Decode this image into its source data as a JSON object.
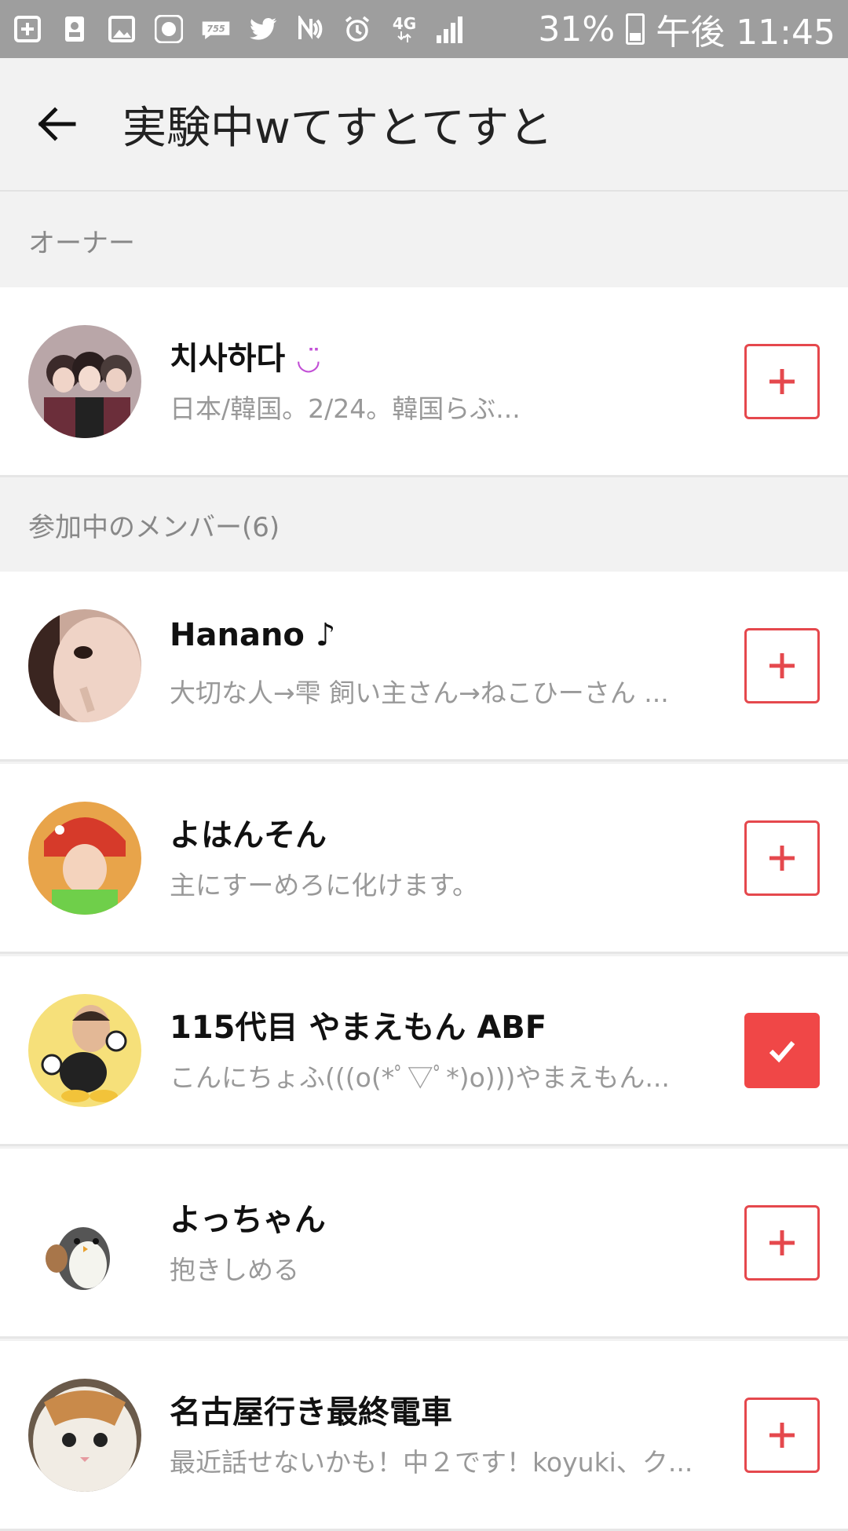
{
  "status_bar": {
    "battery": "31%",
    "time": "午後 11:45",
    "network": "4G",
    "icons": [
      "plus-box-icon",
      "contacts-icon",
      "image-icon",
      "owl-app-icon",
      "755-app-icon",
      "twitter-icon",
      "nfc-icon",
      "alarm-icon",
      "network-4g-icon",
      "signal-icon",
      "battery-icon"
    ]
  },
  "header": {
    "title": "実験中wてすとてすと"
  },
  "owner_section": {
    "label": "オーナー"
  },
  "owner": {
    "name": "치사하다",
    "desc": "日本/韓国。2/24。韓国らぶ..."
  },
  "members_section": {
    "label": "参加中のメンバー(6)"
  },
  "members": [
    {
      "name": "Hanano ♪",
      "desc": "大切な人→雫 飼い主さん→ねこひーさん ..."
    },
    {
      "name": "よはんそん",
      "desc": "主にすーめろに化けます。"
    },
    {
      "name": "115代目 やまえもん ABF",
      "desc": "こんにちょふ(((o(*ﾟ▽ﾟ*)o)))やまえもん..."
    },
    {
      "name": "よっちゃん",
      "desc": "抱きしめる"
    },
    {
      "name": "名古屋行き最終電車",
      "desc": "最近話せないかも！中２です！koyuki、ク..."
    }
  ],
  "colors": {
    "accent": "#e5484d",
    "checked": "#f04747",
    "statusbar": "#9e9e9e"
  }
}
